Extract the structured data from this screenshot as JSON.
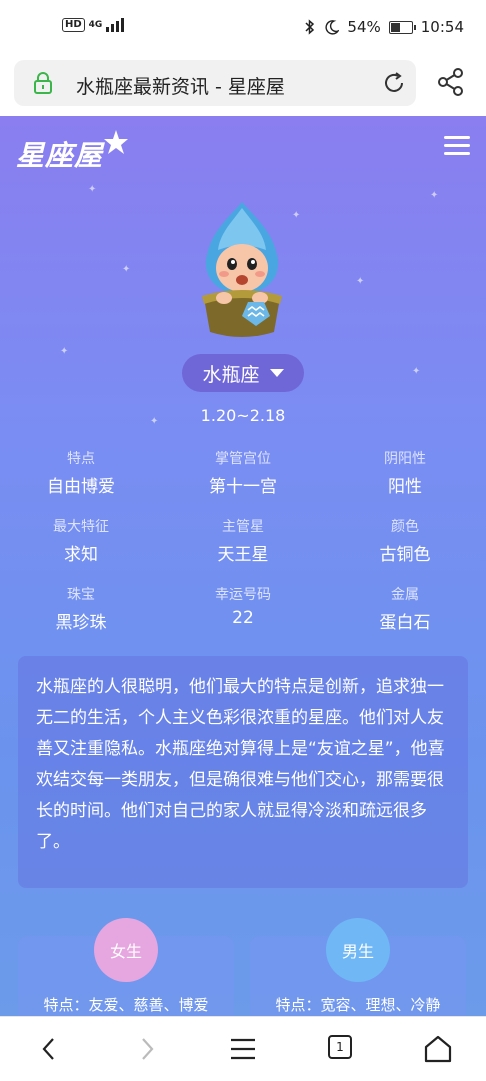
{
  "status_bar": {
    "left_badge": "HD",
    "network": "4G",
    "battery_percent": "54%",
    "battery_level": 0.54,
    "time": "10:54"
  },
  "browser": {
    "url_title": "水瓶座最新资讯 - 星座屋"
  },
  "site": {
    "logo": "星座屋"
  },
  "sign": {
    "name": "水瓶座",
    "date_range": "1.20~2.18"
  },
  "attributes": [
    {
      "label": "特点",
      "value": "自由博爱"
    },
    {
      "label": "掌管宫位",
      "value": "第十一宫"
    },
    {
      "label": "阴阳性",
      "value": "阳性"
    },
    {
      "label": "最大特征",
      "value": "求知"
    },
    {
      "label": "主管星",
      "value": "天王星"
    },
    {
      "label": "颜色",
      "value": "古铜色"
    },
    {
      "label": "珠宝",
      "value": "黑珍珠"
    },
    {
      "label": "幸运号码",
      "value": "22"
    },
    {
      "label": "金属",
      "value": "蛋白石"
    }
  ],
  "description": "水瓶座的人很聪明，他们最大的特点是创新，追求独一无二的生活，个人主义色彩很浓重的星座。他们对人友善又注重隐私。水瓶座绝对算得上是“友谊之星”，他喜欢结交每一类朋友，但是确很难与他们交心，那需要很长的时间。他们对自己的家人就显得冷淡和疏远很多了。",
  "gender_cards": {
    "female": {
      "label": "女生",
      "traits": "特点：友爱、慈善、博爱",
      "color": "#e6a6df"
    },
    "male": {
      "label": "男生",
      "traits": "特点：宽容、理想、冷静",
      "color": "#6fb7f5"
    }
  },
  "nav": {
    "tab_count": "1"
  }
}
